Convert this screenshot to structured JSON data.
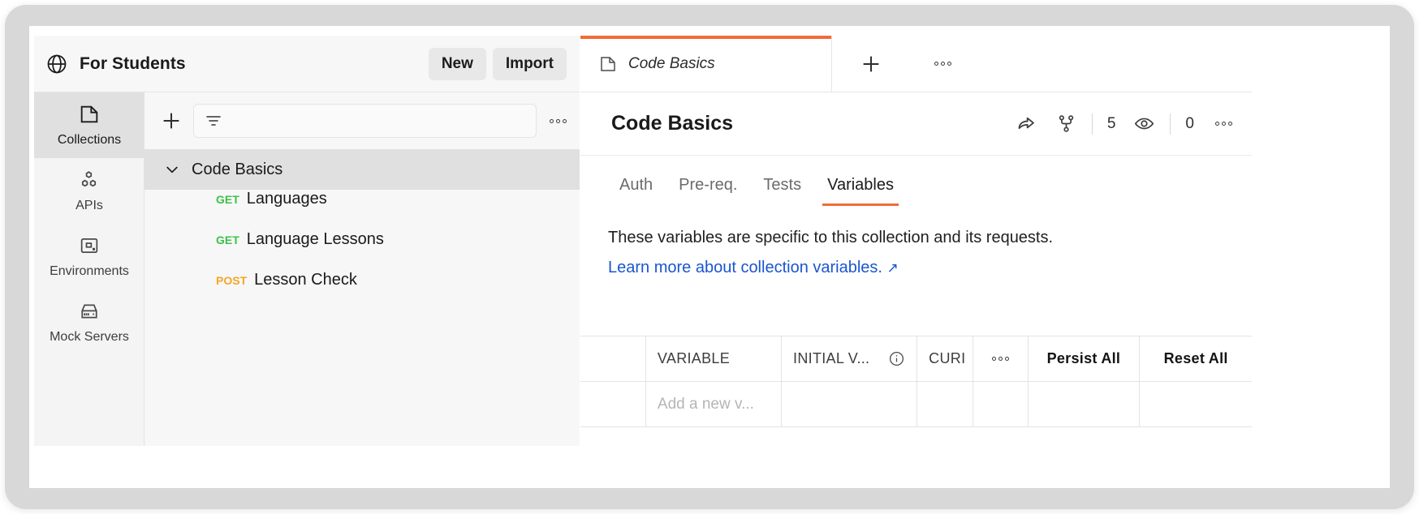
{
  "workspace": {
    "icon": "globe-icon",
    "title": "For Students",
    "new_label": "New",
    "import_label": "Import"
  },
  "sidebar": {
    "items": [
      {
        "label": "Collections",
        "icon": "collection-icon",
        "active": true
      },
      {
        "label": "APIs",
        "icon": "apis-icon",
        "active": false
      },
      {
        "label": "Environments",
        "icon": "environments-icon",
        "active": false
      },
      {
        "label": "Mock Servers",
        "icon": "mock-servers-icon",
        "active": false
      }
    ]
  },
  "collection_panel": {
    "add_icon": "plus-icon",
    "filter_icon": "filter-icon",
    "search_placeholder": "",
    "more_icon": "more-horizontal-icon",
    "tree": {
      "collection_name": "Code Basics",
      "expanded_chevron": "chevron-down-icon",
      "requests": [
        {
          "method": "GET",
          "name": "Languages"
        },
        {
          "method": "GET",
          "name": "Language Lessons"
        },
        {
          "method": "POST",
          "name": "Lesson Check"
        }
      ]
    }
  },
  "editor": {
    "tabs": [
      {
        "label": "Code Basics",
        "icon": "collection-icon",
        "active": true
      }
    ],
    "new_tab_icon": "plus-icon",
    "tab_more_icon": "more-horizontal-icon",
    "collection_title": "Code Basics",
    "actions": {
      "share_icon": "share-arrow-icon",
      "fork_icon": "fork-icon",
      "fork_count": "5",
      "watch_icon": "eye-icon",
      "watch_count": "0",
      "more_icon": "more-horizontal-icon"
    },
    "sub_tabs": [
      {
        "label": "Auth",
        "active": false
      },
      {
        "label": "Pre-req.",
        "active": false
      },
      {
        "label": "Tests",
        "active": false
      },
      {
        "label": "Variables",
        "active": true
      }
    ],
    "description": "These variables are specific to this collection and its requests.",
    "link_text": "Learn more about collection variables.",
    "link_arrow": "↗",
    "variables_table": {
      "columns": [
        {
          "label": "VARIABLE",
          "bold": false
        },
        {
          "label": "INITIAL V...",
          "bold": false
        },
        {
          "label": "CURI",
          "bold": false
        },
        {
          "label": "Persist All",
          "bold": true
        },
        {
          "label": "Reset All",
          "bold": true
        }
      ],
      "info_icon": "info-icon",
      "more_icon": "more-horizontal-icon",
      "new_row_placeholder": "Add a new v..."
    }
  },
  "colors": {
    "accent": "#f26b3a",
    "link": "#1a55d1",
    "get": "#3cc14b",
    "post": "#f5a623"
  }
}
